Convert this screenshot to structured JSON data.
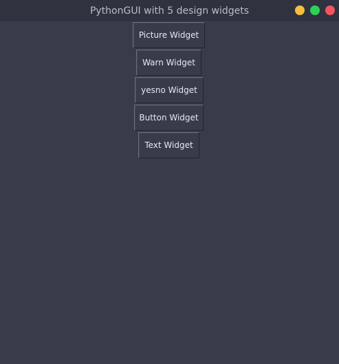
{
  "window": {
    "title": "PythonGUI with 5 design widgets",
    "controls": [
      {
        "name": "minimize",
        "color": "#f5bf3c"
      },
      {
        "name": "maximize",
        "color": "#2ed158"
      },
      {
        "name": "close",
        "color": "#f4545e"
      }
    ]
  },
  "buttons": [
    {
      "label": "Picture Widget"
    },
    {
      "label": "Warn Widget"
    },
    {
      "label": "yesno Widget"
    },
    {
      "label": "Button Widget"
    },
    {
      "label": "Text Widget"
    }
  ],
  "colors": {
    "background": "#393b4b",
    "titlebar": "#30323f",
    "title_text": "#b9bccb",
    "button_text": "#e6e7ee"
  }
}
